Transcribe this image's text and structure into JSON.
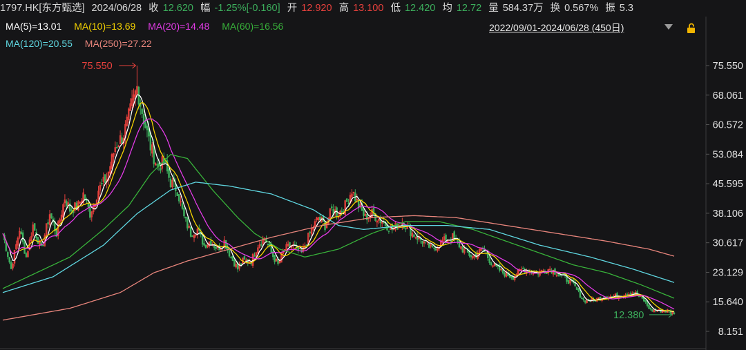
{
  "header": {
    "symbol": "1797.HK[东方甄选]",
    "date": "2024/06/28",
    "close_label": "收",
    "close": "12.620",
    "change_label": "幅",
    "change": "-1.25%[-0.160]",
    "open_label": "开",
    "open": "12.920",
    "high_label": "高",
    "high": "13.100",
    "low_label": "低",
    "low": "12.420",
    "avg_label": "均",
    "avg": "12.72",
    "volume_label": "量",
    "volume": "584.37万",
    "turnover_label": "换",
    "turnover": "0.567%",
    "amplitude_label": "振",
    "amplitude": "5.3"
  },
  "ma_legend": [
    {
      "text": "MA(5)=13.01",
      "color": "#ffffff"
    },
    {
      "text": "MA(10)=13.69",
      "color": "#f5d300"
    },
    {
      "text": "MA(20)=14.48",
      "color": "#e23be6"
    },
    {
      "text": "MA(60)=16.56",
      "color": "#38b23a"
    },
    {
      "text": "MA(120)=20.55",
      "color": "#5fd6e0"
    },
    {
      "text": "MA(250)=27.22",
      "color": "#e8857c"
    }
  ],
  "range_text": "2022/09/01-2024/06/28 (450日)",
  "icons": {
    "dropdown": "dropdown-arrow-icon",
    "lock": "lock-icon"
  },
  "colors": {
    "up": "#e8413d",
    "down": "#3cae5c",
    "background": "#151517"
  },
  "chart_data": {
    "type": "candlestick",
    "x_range": [
      "2022/09/01",
      "2024/06/28"
    ],
    "trading_days": 450,
    "y_ticks": [
      75.55,
      68.061,
      60.572,
      53.084,
      45.595,
      38.106,
      30.617,
      23.129,
      15.64,
      8.151
    ],
    "y_tick_labels": [
      "75.550",
      "68.061",
      "60.572",
      "53.084",
      "45.595",
      "38.106",
      "30.617",
      "23.129",
      "15.640",
      "8.151"
    ],
    "ylim": [
      8.151,
      75.55
    ],
    "annotations": [
      {
        "text": "75.550",
        "value": 75.55,
        "kind": "high",
        "color": "#e8413d"
      },
      {
        "text": "12.380",
        "value": 12.38,
        "kind": "low",
        "color": "#3cae5c"
      }
    ],
    "close_anchors": [
      [
        0,
        33
      ],
      [
        5,
        24
      ],
      [
        10,
        34
      ],
      [
        14,
        27
      ],
      [
        18,
        35
      ],
      [
        23,
        29
      ],
      [
        28,
        38
      ],
      [
        32,
        33
      ],
      [
        37,
        42
      ],
      [
        40,
        39
      ],
      [
        45,
        40
      ],
      [
        48,
        43
      ],
      [
        52,
        38
      ],
      [
        57,
        44
      ],
      [
        62,
        47
      ],
      [
        67,
        55
      ],
      [
        72,
        58
      ],
      [
        76,
        64
      ],
      [
        80,
        70
      ],
      [
        84,
        62
      ],
      [
        88,
        55
      ],
      [
        92,
        50
      ],
      [
        96,
        51
      ],
      [
        100,
        46
      ],
      [
        104,
        44
      ],
      [
        108,
        37
      ],
      [
        112,
        33
      ],
      [
        116,
        34
      ],
      [
        120,
        30
      ],
      [
        124,
        31
      ],
      [
        128,
        29
      ],
      [
        132,
        31
      ],
      [
        136,
        27
      ],
      [
        140,
        24
      ],
      [
        143,
        26
      ],
      [
        148,
        26
      ],
      [
        152,
        30
      ],
      [
        156,
        32
      ],
      [
        160,
        28
      ],
      [
        164,
        25
      ],
      [
        168,
        29
      ],
      [
        172,
        30
      ],
      [
        178,
        28
      ],
      [
        183,
        33
      ],
      [
        188,
        37
      ],
      [
        192,
        35
      ],
      [
        196,
        39
      ],
      [
        200,
        38
      ],
      [
        204,
        40
      ],
      [
        208,
        44
      ],
      [
        212,
        40
      ],
      [
        216,
        37
      ],
      [
        220,
        38
      ],
      [
        226,
        36
      ],
      [
        232,
        34
      ],
      [
        238,
        36
      ],
      [
        244,
        33
      ],
      [
        250,
        31
      ],
      [
        256,
        29
      ],
      [
        262,
        31
      ],
      [
        268,
        32
      ],
      [
        274,
        29
      ],
      [
        280,
        27
      ],
      [
        286,
        29
      ],
      [
        292,
        25
      ],
      [
        298,
        23
      ],
      [
        304,
        22
      ],
      [
        310,
        24
      ],
      [
        318,
        23
      ],
      [
        326,
        24
      ],
      [
        334,
        22
      ],
      [
        340,
        20
      ],
      [
        346,
        16
      ],
      [
        352,
        16
      ],
      [
        358,
        17
      ],
      [
        364,
        17
      ],
      [
        370,
        17.5
      ],
      [
        376,
        18
      ],
      [
        382,
        16
      ],
      [
        386,
        13.5
      ],
      [
        392,
        13.4
      ],
      [
        396,
        13.4
      ],
      [
        400,
        12.62
      ]
    ],
    "ma_series": [
      {
        "name": "MA(60)",
        "color": "#38b23a",
        "values": [
          [
            0,
            19
          ],
          [
            40,
            27
          ],
          [
            60,
            34
          ],
          [
            75,
            40
          ],
          [
            88,
            48
          ],
          [
            100,
            53
          ],
          [
            110,
            52
          ],
          [
            125,
            44
          ],
          [
            140,
            37
          ],
          [
            150,
            33
          ],
          [
            165,
            29
          ],
          [
            180,
            27
          ],
          [
            200,
            29
          ],
          [
            220,
            33
          ],
          [
            240,
            36
          ],
          [
            260,
            36
          ],
          [
            280,
            34
          ],
          [
            300,
            31
          ],
          [
            320,
            28
          ],
          [
            340,
            25
          ],
          [
            360,
            23
          ],
          [
            380,
            20
          ],
          [
            400,
            16.56
          ]
        ]
      },
      {
        "name": "MA(120)",
        "color": "#5fd6e0",
        "values": [
          [
            0,
            18
          ],
          [
            30,
            22
          ],
          [
            60,
            30
          ],
          [
            80,
            38
          ],
          [
            100,
            44
          ],
          [
            115,
            46
          ],
          [
            135,
            45
          ],
          [
            160,
            43
          ],
          [
            185,
            39
          ],
          [
            200,
            35
          ],
          [
            215,
            34
          ],
          [
            240,
            35
          ],
          [
            265,
            35
          ],
          [
            290,
            34
          ],
          [
            320,
            30
          ],
          [
            350,
            27
          ],
          [
            375,
            24
          ],
          [
            400,
            20.55
          ]
        ]
      },
      {
        "name": "MA(250)",
        "color": "#e8857c",
        "values": [
          [
            0,
            11
          ],
          [
            40,
            14
          ],
          [
            70,
            18
          ],
          [
            90,
            23
          ],
          [
            110,
            26
          ],
          [
            135,
            29
          ],
          [
            160,
            32
          ],
          [
            190,
            35
          ],
          [
            220,
            37
          ],
          [
            245,
            37.5
          ],
          [
            270,
            37
          ],
          [
            300,
            35
          ],
          [
            330,
            33
          ],
          [
            360,
            31
          ],
          [
            385,
            29
          ],
          [
            400,
            27.22
          ]
        ]
      }
    ]
  }
}
